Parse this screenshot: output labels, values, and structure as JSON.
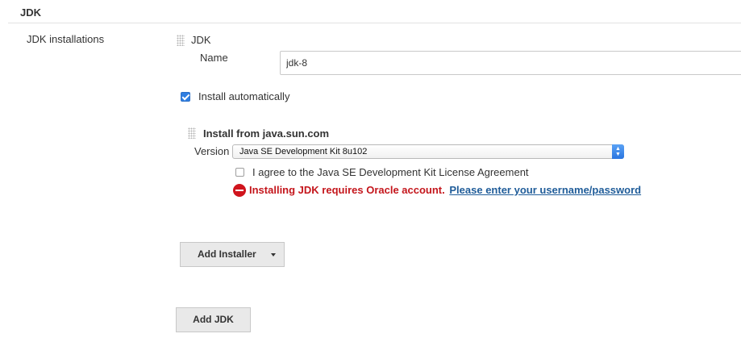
{
  "section": {
    "title": "JDK"
  },
  "jdk_installations": {
    "label": "JDK installations",
    "entry_heading": "JDK",
    "name_label": "Name",
    "name_value": "jdk-8",
    "install_automatically": {
      "label": "Install automatically",
      "checked": true
    },
    "installer": {
      "title": "Install from java.sun.com",
      "version_label": "Version",
      "version_selected": "Java SE Development Kit 8u102",
      "agree_label": "I agree to the Java SE Development Kit License Agreement",
      "agree_checked": false,
      "error_text": "Installing JDK requires Oracle account.",
      "error_link": "Please enter your username/password"
    },
    "add_installer_label": "Add Installer",
    "add_jdk_label": "Add JDK"
  },
  "colors": {
    "error": "#c4161c",
    "link": "#1f5c99",
    "accent": "#2f7ee1"
  },
  "icons": {
    "drag_handle": "drag-handle-icon",
    "error": "error-icon",
    "select_arrows": "select-arrows-icon",
    "dropdown_caret": "caret-down-icon",
    "checkbox": "checkmark-icon"
  }
}
